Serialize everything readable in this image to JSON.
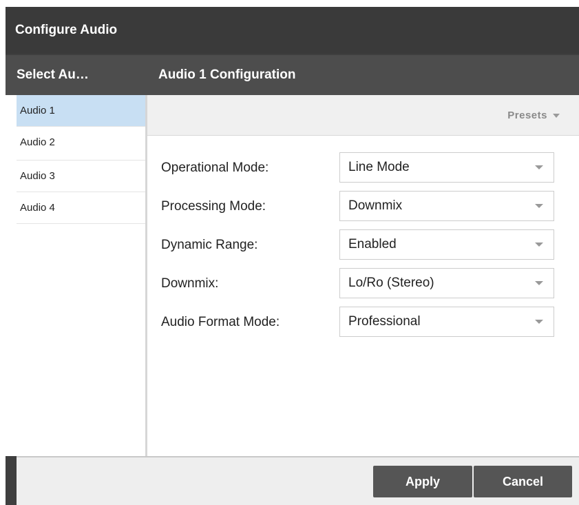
{
  "dialog": {
    "title": "Configure Audio"
  },
  "header": {
    "left_title": "Select Au…",
    "right_title": "Audio 1 Configuration"
  },
  "sidebar": {
    "items": [
      {
        "label": "Audio 1",
        "selected": true
      },
      {
        "label": "Audio 2",
        "selected": false
      },
      {
        "label": "Audio 3",
        "selected": false
      },
      {
        "label": "Audio 4",
        "selected": false
      }
    ]
  },
  "presets": {
    "label": "Presets"
  },
  "form": {
    "fields": [
      {
        "label": "Operational Mode:",
        "value": "Line Mode"
      },
      {
        "label": "Processing Mode:",
        "value": "Downmix"
      },
      {
        "label": "Dynamic Range:",
        "value": "Enabled"
      },
      {
        "label": "Downmix:",
        "value": "Lo/Ro (Stereo)"
      },
      {
        "label": "Audio Format Mode:",
        "value": "Professional"
      }
    ]
  },
  "footer": {
    "apply_label": "Apply",
    "cancel_label": "Cancel"
  },
  "colors": {
    "title_bar": "#3a3a3a",
    "header": "#4d4d4d",
    "selected_item": "#c8dff3",
    "button": "#555555"
  }
}
